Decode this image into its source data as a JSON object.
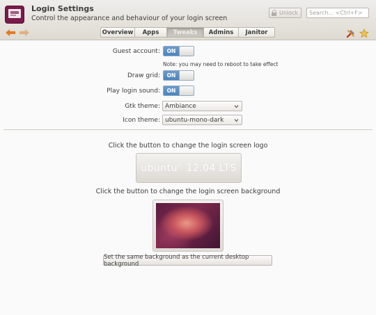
{
  "header": {
    "title": "Login Settings",
    "subtitle": "Control the appearance and behaviour of your login screen",
    "unlock_label": "Unlock",
    "search_placeholder": "Search... <Ctrl+F>"
  },
  "tabs": [
    {
      "label": "Overview",
      "active": false
    },
    {
      "label": "Apps",
      "active": false
    },
    {
      "label": "Tweaks",
      "active": true
    },
    {
      "label": "Admins",
      "active": false
    },
    {
      "label": "Janitor",
      "active": false
    }
  ],
  "settings": {
    "guest_account": {
      "label": "Guest account:",
      "state": "ON"
    },
    "guest_note": "Note: you may need to reboot to take effect",
    "draw_grid": {
      "label": "Draw grid:",
      "state": "ON"
    },
    "login_sound": {
      "label": "Play login sound:",
      "state": "ON"
    },
    "gtk_theme": {
      "label": "Gtk theme:",
      "value": "Ambiance"
    },
    "icon_theme": {
      "label": "Icon theme:",
      "value": "ubuntu-mono-dark"
    }
  },
  "appearance": {
    "logo_prompt": "Click the button to change the login screen logo",
    "logo_text": "ubuntu",
    "logo_version": "12.04 LTS",
    "background_prompt": "Click the button to change the login screen background",
    "same_bg_label": "Set the same background as the current desktop background"
  },
  "colors": {
    "accent_blue": "#5a8fc4",
    "header_bg": "#e6e3dc",
    "brand_purple": "#7a1a4a"
  },
  "icons": {
    "app": "login-settings-icon",
    "back": "arrow-left-icon",
    "forward": "arrow-right-icon",
    "unlock": "lock-icon",
    "tools": "tools-icon",
    "favorite": "star-icon"
  }
}
